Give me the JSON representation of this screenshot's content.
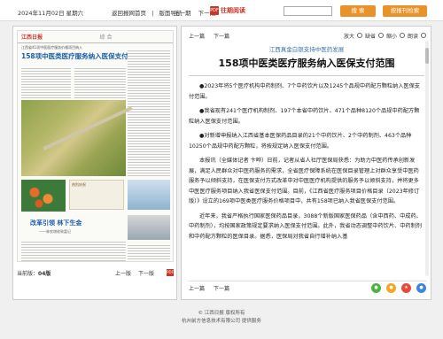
{
  "topbar": {
    "date": "2024年11月02日 星期六",
    "links": [
      "返回报网首页",
      "版面导航"
    ],
    "nav": [
      "上一期",
      "下一期"
    ],
    "pdf_icon": "pdf-icon",
    "read_label": "往期阅读",
    "search_placeholder": "",
    "search_button": "搜 索",
    "advanced_button": "按报刊检索"
  },
  "newspaper": {
    "brand": "江西日报",
    "section": "综 合",
    "small_title": "江西省41项中医医疗服务价格项目纳入",
    "title": "158项中医类医疗服务纳入医保支付范围",
    "box_text": "热烈庆祝",
    "foot_title": "改革引领 林下生金",
    "foot_sub": "——林农增收致富记"
  },
  "left_footer": {
    "edition_label": "当前版：",
    "edition": "04版",
    "prev": "上一版",
    "next": "下一版"
  },
  "article": {
    "prev": "上一篇",
    "next": "下一篇",
    "zoom_in": "放大",
    "zoom_default": "缺省",
    "zoom_out": "缩小",
    "read_aloud": "朗读",
    "kicker": "江西真金白银支持中医药发展",
    "headline": "158项中医类医疗服务纳入医保支付范围",
    "paragraphs": [
      "●2023年将5个医疗机构中药制剂、7个中药饮片以及1245个品规中药配方颗粒纳入医保支付范围。",
      "●我省现有241个医疗机构制剂、197个本省中药饮片、471个品种8120个品规中药配方颗粒纳入医保支付范围。",
      "●对新增申报纳入江西省基本医保药品目录的21个中药饮片、2个中药制剂、463个品种10250个品规中药配方颗粒，将按规定纳入医保支付范围。",
      "本报讯（全媒体记者 卞晔）日前，记者从省人社厅医保局获悉：为助力中医药传承创新发展，满足人民群众对中医药服务的需求，全省医疗保障系统在医保目录管理上对群众享受中医药服务予以倾斜支持，在医保支付方式改革中对中医医疗机构提供的服务予以倾斜支持，并将更多中医医疗服务项目纳入我省医保支付范围。目前，《江西省医疗服务项目价格目录（2023年修订版）》设立的169项中医类医疗服务价格项目中，共有158项已纳入我省医保支付范围。",
      "近年来，我省严格执行国家医保药品目录，3088个新版国家医保药品（含中西药、中成药、中药制剂），均按国家政策规定要求纳入医保支付范围。此外，我省动态调整中药饮片、中药制剂和中药配方颗粒的医保目录。据悉，医保局对我省自行增补纳入基"
    ]
  },
  "share_icons": [
    "wechat-icon",
    "weibo-icon",
    "qzone-icon",
    "baidu-icon"
  ],
  "share_colors": [
    "#4fb142",
    "#f5a623",
    "#e84a3a",
    "#3d87d9"
  ],
  "footer": {
    "line1": "© 江西日报 版权所有",
    "line2": "杭州前方信息技术有限公司  提供服务"
  }
}
